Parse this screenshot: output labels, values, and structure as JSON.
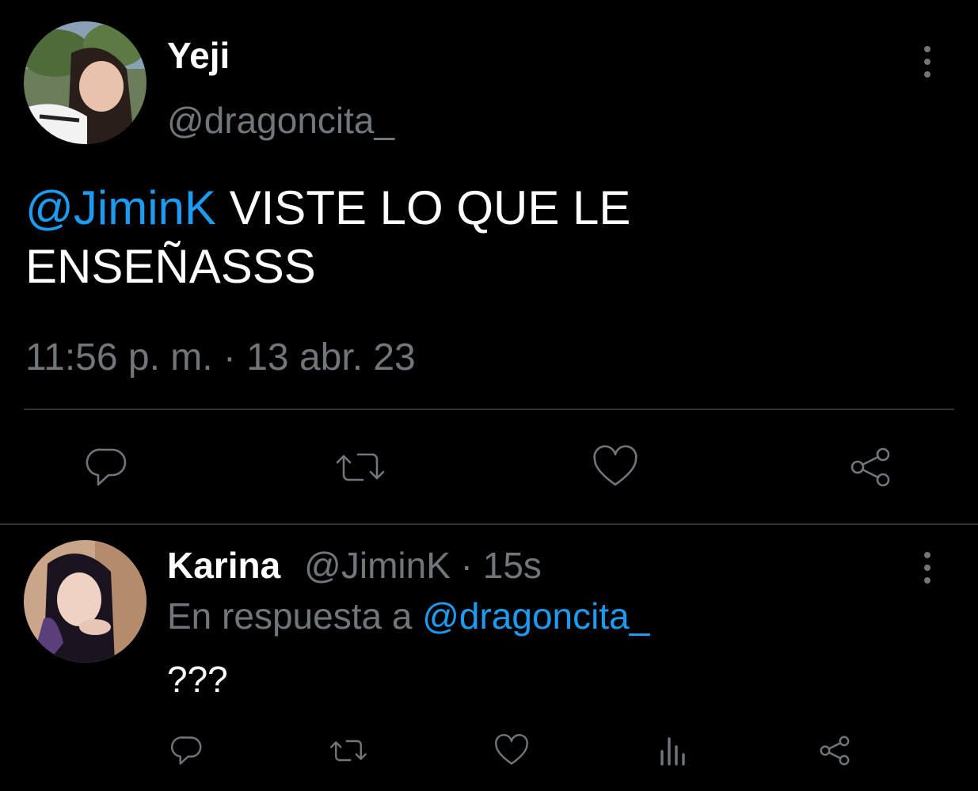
{
  "tweet": {
    "author_name": "Yeji",
    "author_handle": "@dragoncita_",
    "mention": "@JiminK",
    "text_line1": " VISTE LO QUE LE",
    "text_line2": "ENSEÑASSS",
    "timestamp": "11:56 p. m. · 13 abr. 23",
    "actions": [
      "reply-icon",
      "retweet-icon",
      "like-icon",
      "share-icon"
    ]
  },
  "reply": {
    "author_name": "Karina",
    "author_handle": "@JiminK",
    "time_ago": " · 15s",
    "in_reply_prefix": "En respuesta a ",
    "in_reply_handle": "@dragoncita_",
    "text": "???",
    "actions": [
      "reply-icon",
      "retweet-icon",
      "like-icon",
      "views-icon",
      "share-icon"
    ]
  },
  "colors": {
    "background": "#000000",
    "text": "#ffffff",
    "muted": "#71767b",
    "link": "#1d9bf0",
    "divider": "#2f3336"
  }
}
